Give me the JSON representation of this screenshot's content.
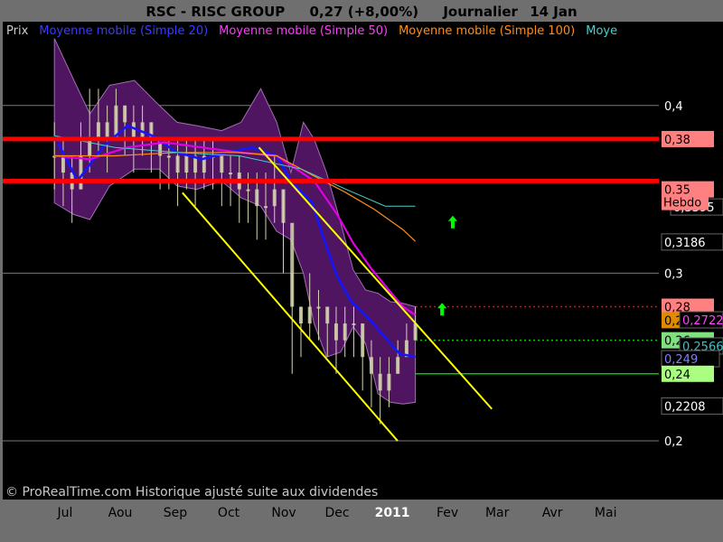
{
  "header": {
    "ticker": "RSC - RISC GROUP",
    "quote": "0,27 (+8,00%)",
    "period": "Journalier",
    "date": "14 Jan"
  },
  "legend": [
    {
      "label": "Prix",
      "color": "#cccccc"
    },
    {
      "label": "Moyenne mobile (Simple 20)",
      "color": "#3b3bff"
    },
    {
      "label": "Moyenne mobile (Simple 50)",
      "color": "#ff3cff"
    },
    {
      "label": "Moyenne mobile (Simple 100)",
      "color": "#ff8c1a"
    },
    {
      "label": "Moye",
      "color": "#49d0c8"
    }
  ],
  "footer": {
    "copyright": "© ProRealTime.com Historique ajusté suite aux dividendes"
  },
  "colors": {
    "background": "#000000",
    "frame": "#6f6f6f",
    "header_text": "#000000",
    "bollinger_fill": "#4f1560",
    "bollinger_edge": "#a070b0",
    "candle": "#d6d6b0",
    "ma20": "#1515ff",
    "ma50": "#e000e0",
    "ma100": "#ff8c1a",
    "ma200": "#49d0c8",
    "resistance": "#ff0000",
    "trendline": "#ffff00",
    "arrow": "#00ff00",
    "gridline": "#7a7a7a"
  },
  "chart_data": {
    "type": "line",
    "title": "RSC - RISC GROUP",
    "xlabel": "",
    "ylabel": "",
    "x_ticks": [
      "Jul",
      "Aou",
      "Sep",
      "Oct",
      "Nov",
      "Dec",
      "2011",
      "Fev",
      "Mar",
      "Avr",
      "Mai"
    ],
    "y_ticks": [
      "0,2",
      "0,3",
      "0,4"
    ],
    "ylim": [
      0.165,
      0.45
    ],
    "grid": true,
    "legend_position": "top",
    "series": [
      {
        "name": "Moyenne mobile (Simple 20)",
        "color": "#1515ff",
        "x": [
          "2010-06-25",
          "2010-07-08",
          "2010-07-22",
          "2010-08-05",
          "2010-08-19",
          "2010-09-02",
          "2010-09-16",
          "2010-09-30",
          "2010-10-14",
          "2010-10-28",
          "2010-11-05",
          "2010-11-11",
          "2010-11-17",
          "2010-11-23",
          "2010-12-01",
          "2010-12-09",
          "2010-12-17",
          "2010-12-27",
          "2011-01-05",
          "2011-01-14"
        ],
        "values": [
          0.382,
          0.355,
          0.375,
          0.388,
          0.382,
          0.372,
          0.368,
          0.372,
          0.375,
          0.37,
          0.355,
          0.348,
          0.342,
          0.322,
          0.298,
          0.283,
          0.275,
          0.263,
          0.252,
          0.25
        ]
      },
      {
        "name": "Moyenne mobile (Simple 50)",
        "color": "#e000e0",
        "x": [
          "2010-06-25",
          "2010-07-15",
          "2010-08-05",
          "2010-08-26",
          "2010-09-16",
          "2010-10-07",
          "2010-10-28",
          "2010-11-18",
          "2010-12-01",
          "2010-12-10",
          "2010-12-20",
          "2010-12-30",
          "2011-01-07",
          "2011-01-14"
        ],
        "values": [
          0.37,
          0.368,
          0.375,
          0.378,
          0.375,
          0.372,
          0.37,
          0.355,
          0.335,
          0.318,
          0.303,
          0.29,
          0.28,
          0.275
        ]
      },
      {
        "name": "Moyenne mobile (Simple 100)",
        "color": "#ff8c1a",
        "x": [
          "2010-06-25",
          "2010-07-29",
          "2010-09-02",
          "2010-10-07",
          "2010-10-28",
          "2010-11-18",
          "2010-12-06",
          "2010-12-22",
          "2011-01-07",
          "2011-01-14"
        ],
        "values": [
          0.37,
          0.37,
          0.372,
          0.372,
          0.37,
          0.358,
          0.348,
          0.338,
          0.326,
          0.319
        ]
      },
      {
        "name": "Moye",
        "color": "#49d0c8",
        "x": [
          "2010-06-25",
          "2010-07-29",
          "2010-09-02",
          "2010-10-07",
          "2010-11-11",
          "2010-12-06",
          "2010-12-28",
          "2011-01-14"
        ],
        "values": [
          0.382,
          0.375,
          0.372,
          0.37,
          0.362,
          0.35,
          0.34,
          0.34
        ]
      }
    ],
    "bollinger": {
      "x": [
        "2010-06-25",
        "2010-07-06",
        "2010-07-15",
        "2010-07-26",
        "2010-08-09",
        "2010-08-23",
        "2010-09-02",
        "2010-09-13",
        "2010-09-27",
        "2010-10-08",
        "2010-10-19",
        "2010-10-28",
        "2010-11-05",
        "2010-11-12",
        "2010-11-18",
        "2010-11-25",
        "2010-12-03",
        "2010-12-10",
        "2010-12-17",
        "2010-12-24",
        "2010-12-31",
        "2011-01-07",
        "2011-01-14"
      ],
      "upper": [
        0.44,
        0.415,
        0.395,
        0.412,
        0.415,
        0.4,
        0.39,
        0.388,
        0.385,
        0.39,
        0.41,
        0.39,
        0.36,
        0.39,
        0.38,
        0.36,
        0.33,
        0.302,
        0.29,
        0.288,
        0.283,
        0.282,
        0.28
      ],
      "lower": [
        0.342,
        0.335,
        0.332,
        0.352,
        0.362,
        0.362,
        0.352,
        0.35,
        0.355,
        0.345,
        0.34,
        0.325,
        0.32,
        0.3,
        0.27,
        0.25,
        0.253,
        0.268,
        0.258,
        0.228,
        0.223,
        0.222,
        0.223
      ]
    },
    "price_candles": {
      "start_date": "2010-06-25",
      "end_date": "2011-01-14",
      "close": [
        0.37,
        0.36,
        0.35,
        0.37,
        0.38,
        0.39,
        0.38,
        0.4,
        0.39,
        0.38,
        0.39,
        0.38,
        0.37,
        0.37,
        0.36,
        0.37,
        0.36,
        0.37,
        0.37,
        0.36,
        0.36,
        0.35,
        0.35,
        0.34,
        0.34,
        0.35,
        0.33,
        0.28,
        0.27,
        0.28,
        0.28,
        0.27,
        0.26,
        0.27,
        0.27,
        0.25,
        0.24,
        0.23,
        0.24,
        0.25,
        0.26,
        0.27
      ],
      "high": [
        0.39,
        0.38,
        0.37,
        0.39,
        0.41,
        0.41,
        0.4,
        0.41,
        0.4,
        0.4,
        0.4,
        0.39,
        0.38,
        0.38,
        0.38,
        0.38,
        0.38,
        0.38,
        0.38,
        0.37,
        0.37,
        0.37,
        0.36,
        0.36,
        0.36,
        0.37,
        0.35,
        0.3,
        0.28,
        0.3,
        0.29,
        0.28,
        0.28,
        0.28,
        0.28,
        0.27,
        0.26,
        0.25,
        0.25,
        0.26,
        0.27,
        0.28
      ],
      "low": [
        0.35,
        0.34,
        0.33,
        0.35,
        0.36,
        0.37,
        0.36,
        0.38,
        0.37,
        0.36,
        0.37,
        0.36,
        0.35,
        0.35,
        0.34,
        0.35,
        0.34,
        0.35,
        0.35,
        0.34,
        0.34,
        0.33,
        0.33,
        0.32,
        0.32,
        0.33,
        0.3,
        0.24,
        0.25,
        0.26,
        0.26,
        0.25,
        0.24,
        0.25,
        0.25,
        0.23,
        0.22,
        0.21,
        0.22,
        0.24,
        0.25,
        0.26
      ]
    },
    "horizontal_lines": [
      {
        "value": 0.38,
        "label": "0,38",
        "color": "#ff0000",
        "style": "solid"
      },
      {
        "value": 0.355,
        "label": "0,35",
        "color": "#ff0000",
        "style": "solid"
      },
      {
        "value": 0.28,
        "label": "0,28",
        "color": "#ff0000",
        "style": "dotted"
      },
      {
        "value": 0.26,
        "label": "0,26",
        "color": "#00cc00",
        "style": "dotted"
      },
      {
        "value": 0.24,
        "label": "0,24",
        "color": "#00cc00",
        "style": "solid"
      }
    ],
    "trend_lines": [
      {
        "x": [
          "2010-09-05",
          "2011-01-04"
        ],
        "y": [
          0.348,
          0.2
        ]
      },
      {
        "x": [
          "2010-10-18",
          "2011-02-26"
        ],
        "y": [
          0.375,
          0.219
        ]
      }
    ],
    "arrows": [
      {
        "x": "2011-01-29",
        "y": 0.278
      },
      {
        "x": "2011-02-04",
        "y": 0.33
      }
    ],
    "price_labels": [
      {
        "value": 0.38,
        "text": "0,38",
        "bg": "#ff8080",
        "fg": "#000000",
        "row": 0
      },
      {
        "value": 0.35,
        "text": "0,35",
        "bg": "#ff8080",
        "fg": "#000000",
        "row": 0
      },
      {
        "value": 0.3395,
        "text": "0,3395",
        "bg": "#000000",
        "fg": "#ffffff",
        "row": 1
      },
      {
        "value": 0.3186,
        "text": "0,3186",
        "bg": "#000000",
        "fg": "#ffffff",
        "row": 0
      },
      {
        "value": 0.28,
        "text": "0,28",
        "bg": "#ff8080",
        "fg": "#000000",
        "row": 0
      },
      {
        "value": 0.272,
        "text": "0,272",
        "bg": "#e08a00",
        "fg": "#000000",
        "row": 0
      },
      {
        "value": 0.2722,
        "text": "0,2722",
        "bg": "#000000",
        "fg": "#ff40ff",
        "row": 2
      },
      {
        "value": 0.26,
        "text": "0,26",
        "bg": "#80e080",
        "fg": "#000000",
        "row": 0
      },
      {
        "value": 0.2566,
        "text": "0,2566",
        "bg": "#000000",
        "fg": "#40c0c0",
        "row": 2
      },
      {
        "value": 0.249,
        "text": "0,249",
        "bg": "#000000",
        "fg": "#8080ff",
        "row": 0
      },
      {
        "value": 0.24,
        "text": "0,24",
        "bg": "#aaff80",
        "fg": "#000000",
        "row": 0
      },
      {
        "value": 0.2208,
        "text": "0,2208",
        "bg": "#000000",
        "fg": "#ffffff",
        "row": 0
      }
    ],
    "annotations": [
      {
        "text": "Hebdo",
        "anchor_value": 0.35
      }
    ]
  }
}
